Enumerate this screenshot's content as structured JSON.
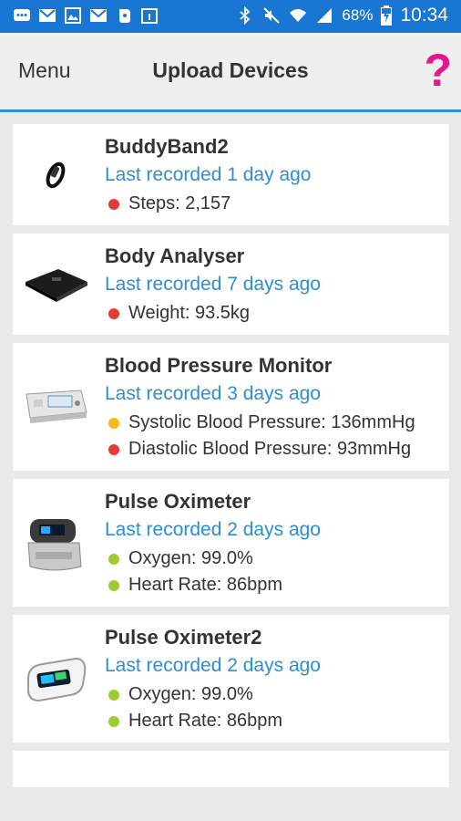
{
  "status_bar": {
    "battery": "68%",
    "time": "10:34"
  },
  "header": {
    "menu_label": "Menu",
    "title": "Upload Devices",
    "help_label": "?"
  },
  "devices": [
    {
      "name": "BuddyBand2",
      "last_recorded": "Last recorded 1 day ago",
      "readings": [
        {
          "text": "Steps: 2,157",
          "status_color": "#e53935"
        }
      ]
    },
    {
      "name": "Body Analyser",
      "last_recorded": "Last recorded 7 days ago",
      "readings": [
        {
          "text": "Weight: 93.5kg",
          "status_color": "#e53935"
        }
      ]
    },
    {
      "name": "Blood Pressure Monitor",
      "last_recorded": "Last recorded 3 days ago",
      "readings": [
        {
          "text": "Systolic Blood Pressure: 136mmHg",
          "status_color": "#f5b914"
        },
        {
          "text": "Diastolic Blood Pressure: 93mmHg",
          "status_color": "#e53935"
        }
      ]
    },
    {
      "name": "Pulse Oximeter",
      "last_recorded": "Last recorded 2 days ago",
      "readings": [
        {
          "text": "Oxygen: 99.0%",
          "status_color": "#9acd32"
        },
        {
          "text": "Heart Rate: 86bpm",
          "status_color": "#9acd32"
        }
      ]
    },
    {
      "name": "Pulse Oximeter2",
      "last_recorded": "Last recorded 2 days ago",
      "readings": [
        {
          "text": "Oxygen: 99.0%",
          "status_color": "#9acd32"
        },
        {
          "text": "Heart Rate: 86bpm",
          "status_color": "#9acd32"
        }
      ]
    }
  ],
  "colors": {
    "status_bar": "#1976d2",
    "accent": "#2b8ed6",
    "help": "#e6178b"
  }
}
